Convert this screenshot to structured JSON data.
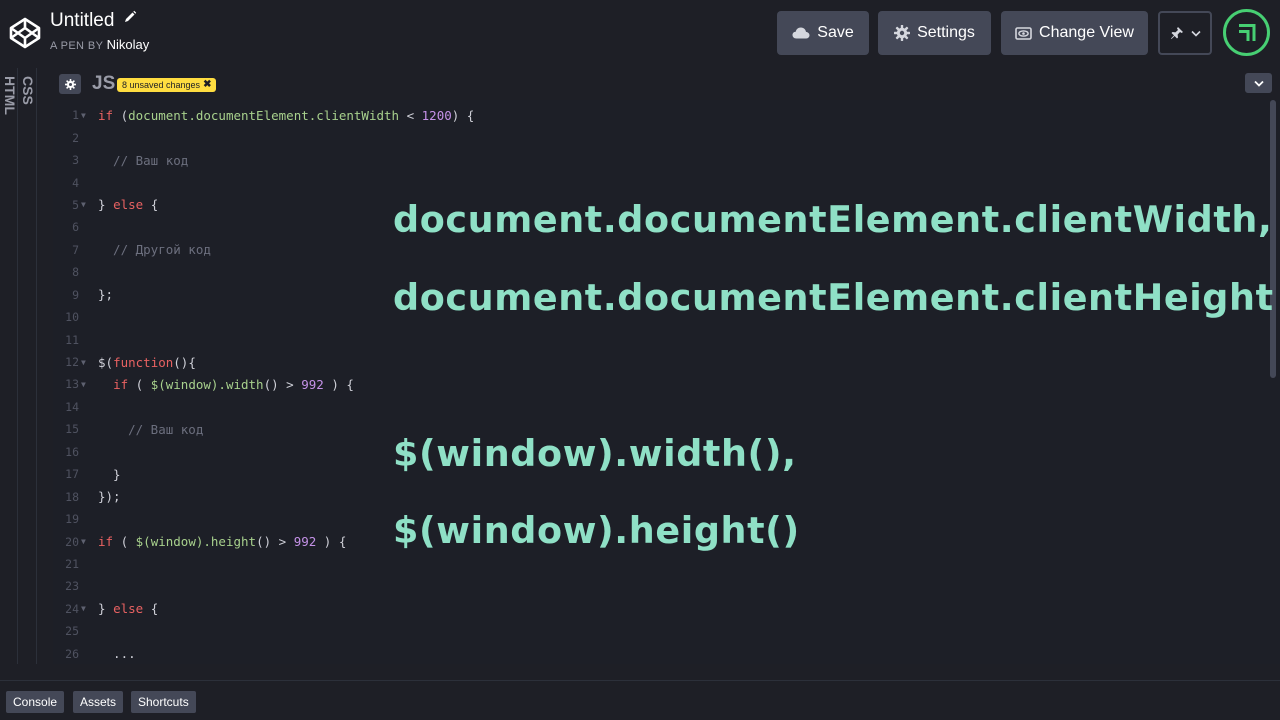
{
  "header": {
    "title": "Untitled",
    "byline_prefix": "A PEN BY",
    "author": "Nikolay",
    "buttons": {
      "save": "Save",
      "settings": "Settings",
      "change_view": "Change View"
    }
  },
  "panels": {
    "html": "HTML",
    "css": "CSS",
    "js": "JS"
  },
  "badge": {
    "unsaved": "8 unsaved changes"
  },
  "code_lines": [
    {
      "n": "1",
      "fold": true
    },
    {
      "n": "2"
    },
    {
      "n": "3"
    },
    {
      "n": "4"
    },
    {
      "n": "5",
      "fold": true
    },
    {
      "n": "6"
    },
    {
      "n": "7"
    },
    {
      "n": "8"
    },
    {
      "n": "9"
    },
    {
      "n": "10"
    },
    {
      "n": "11"
    },
    {
      "n": "12",
      "fold": true
    },
    {
      "n": "13",
      "fold": true
    },
    {
      "n": "14"
    },
    {
      "n": "15"
    },
    {
      "n": "16"
    },
    {
      "n": "17"
    },
    {
      "n": "18"
    },
    {
      "n": "19"
    },
    {
      "n": "20",
      "fold": true
    },
    {
      "n": "21"
    },
    {
      "n": "23"
    },
    {
      "n": "24",
      "fold": true
    },
    {
      "n": "25"
    },
    {
      "n": "26"
    }
  ],
  "code_text": {
    "l1_a": "if",
    "l1_b": " (",
    "l1_c": "document.documentElement.clientWidth",
    "l1_d": " < ",
    "l1_e": "1200",
    "l1_f": ") {",
    "l3": "  // Ваш код",
    "l5_a": "} ",
    "l5_b": "else",
    "l5_c": " {",
    "l7": "  // Другой код",
    "l9": "};",
    "l12_a": "$(",
    "l12_b": "function",
    "l12_c": "(){",
    "l13_a": "  ",
    "l13_b": "if",
    "l13_c": " ( ",
    "l13_d": "$(window).width",
    "l13_e": "() > ",
    "l13_f": "992",
    "l13_g": " ) {",
    "l15": "    // Ваш код",
    "l17": "  }",
    "l18": "});",
    "l20_a": "if",
    "l20_b": " ( ",
    "l20_c": "$(window).height",
    "l20_d": "() > ",
    "l20_e": "992",
    "l20_f": " ) {",
    "l24_a": "} ",
    "l24_b": "else",
    "l24_c": " {",
    "l26": "  ..."
  },
  "overlay": {
    "line1": "document.documentElement.clientWidth,",
    "line2": "document.documentElement.clientHeight",
    "line3": "$(window).width(),",
    "line4": "$(window).height()"
  },
  "footer": {
    "console": "Console",
    "assets": "Assets",
    "shortcuts": "Shortcuts"
  },
  "colors": {
    "background": "#1e1f26",
    "button": "#444857",
    "accent_green": "#47cf73",
    "badge_yellow": "#ffdd40",
    "overlay_text": "#8fe0c6",
    "keyword": "#e96262",
    "number": "#c592e8"
  },
  "icons": [
    "codepen-logo-icon",
    "pencil-icon",
    "cloud-icon",
    "gear-icon",
    "eye-icon",
    "pin-icon",
    "chevron-down-icon",
    "close-icon"
  ]
}
